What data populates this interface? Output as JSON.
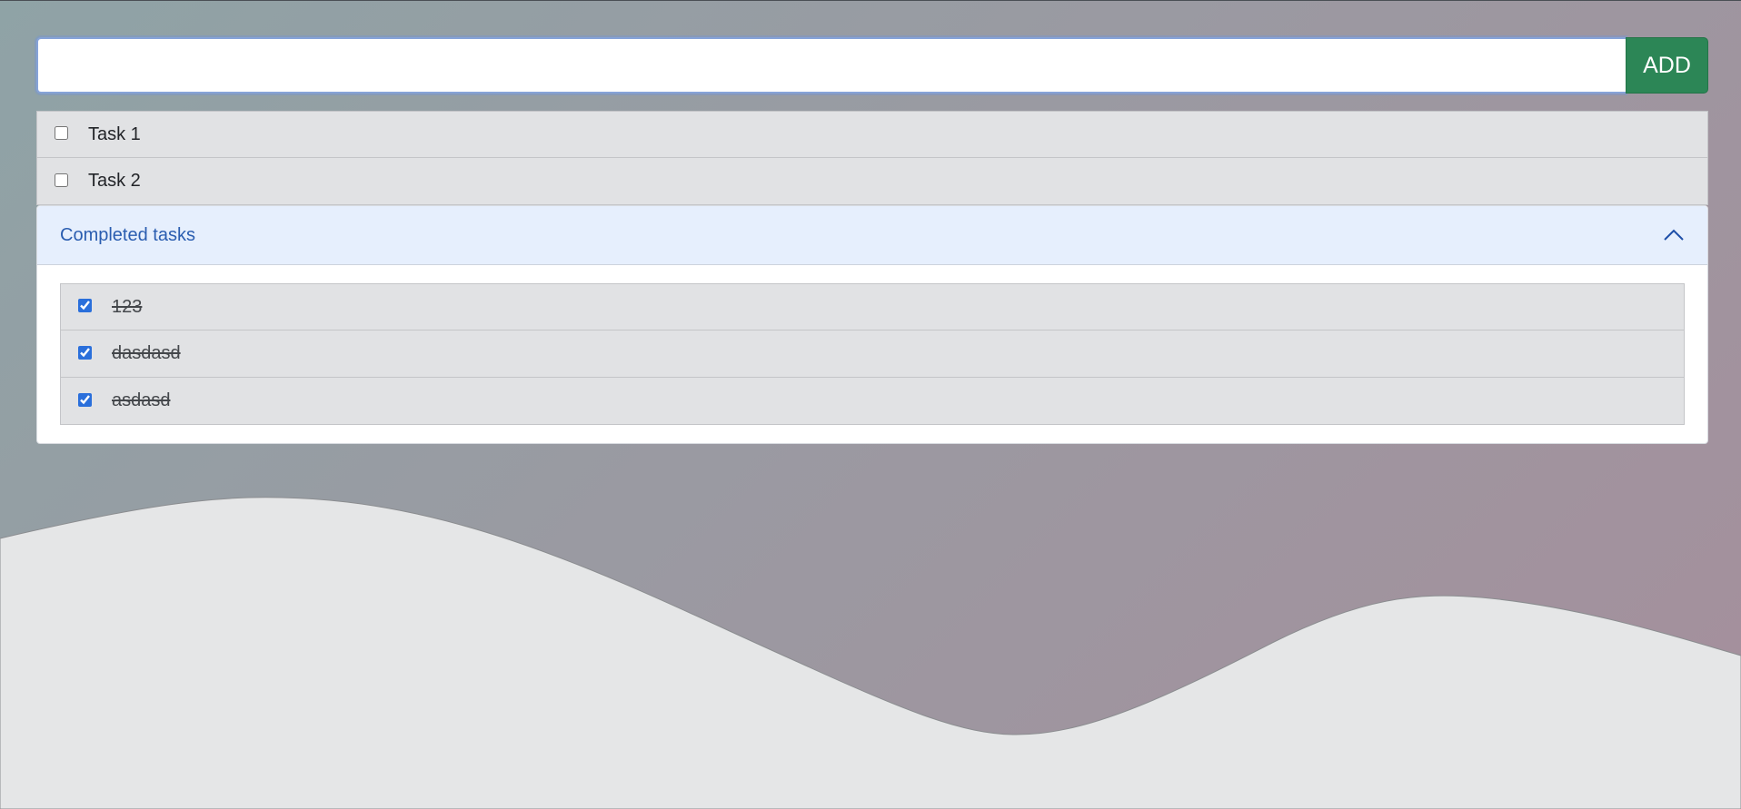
{
  "form": {
    "input_value": "",
    "input_placeholder": "",
    "add_label": "ADD"
  },
  "tasks": [
    {
      "label": "Task 1",
      "checked": false
    },
    {
      "label": "Task 2",
      "checked": false
    }
  ],
  "completed": {
    "title": "Completed tasks",
    "expanded": true,
    "items": [
      {
        "label": "123",
        "checked": true
      },
      {
        "label": "dasdasd",
        "checked": true
      },
      {
        "label": "asdasd",
        "checked": true
      }
    ]
  },
  "icons": {
    "toggle": "chevron-up-icon"
  },
  "colors": {
    "add_button": "#2c8656",
    "accent": "#2a6fdb",
    "accordion_title": "#2a5db0",
    "accordion_header_bg": "#e6effd",
    "task_row_bg": "#e1e2e4"
  }
}
